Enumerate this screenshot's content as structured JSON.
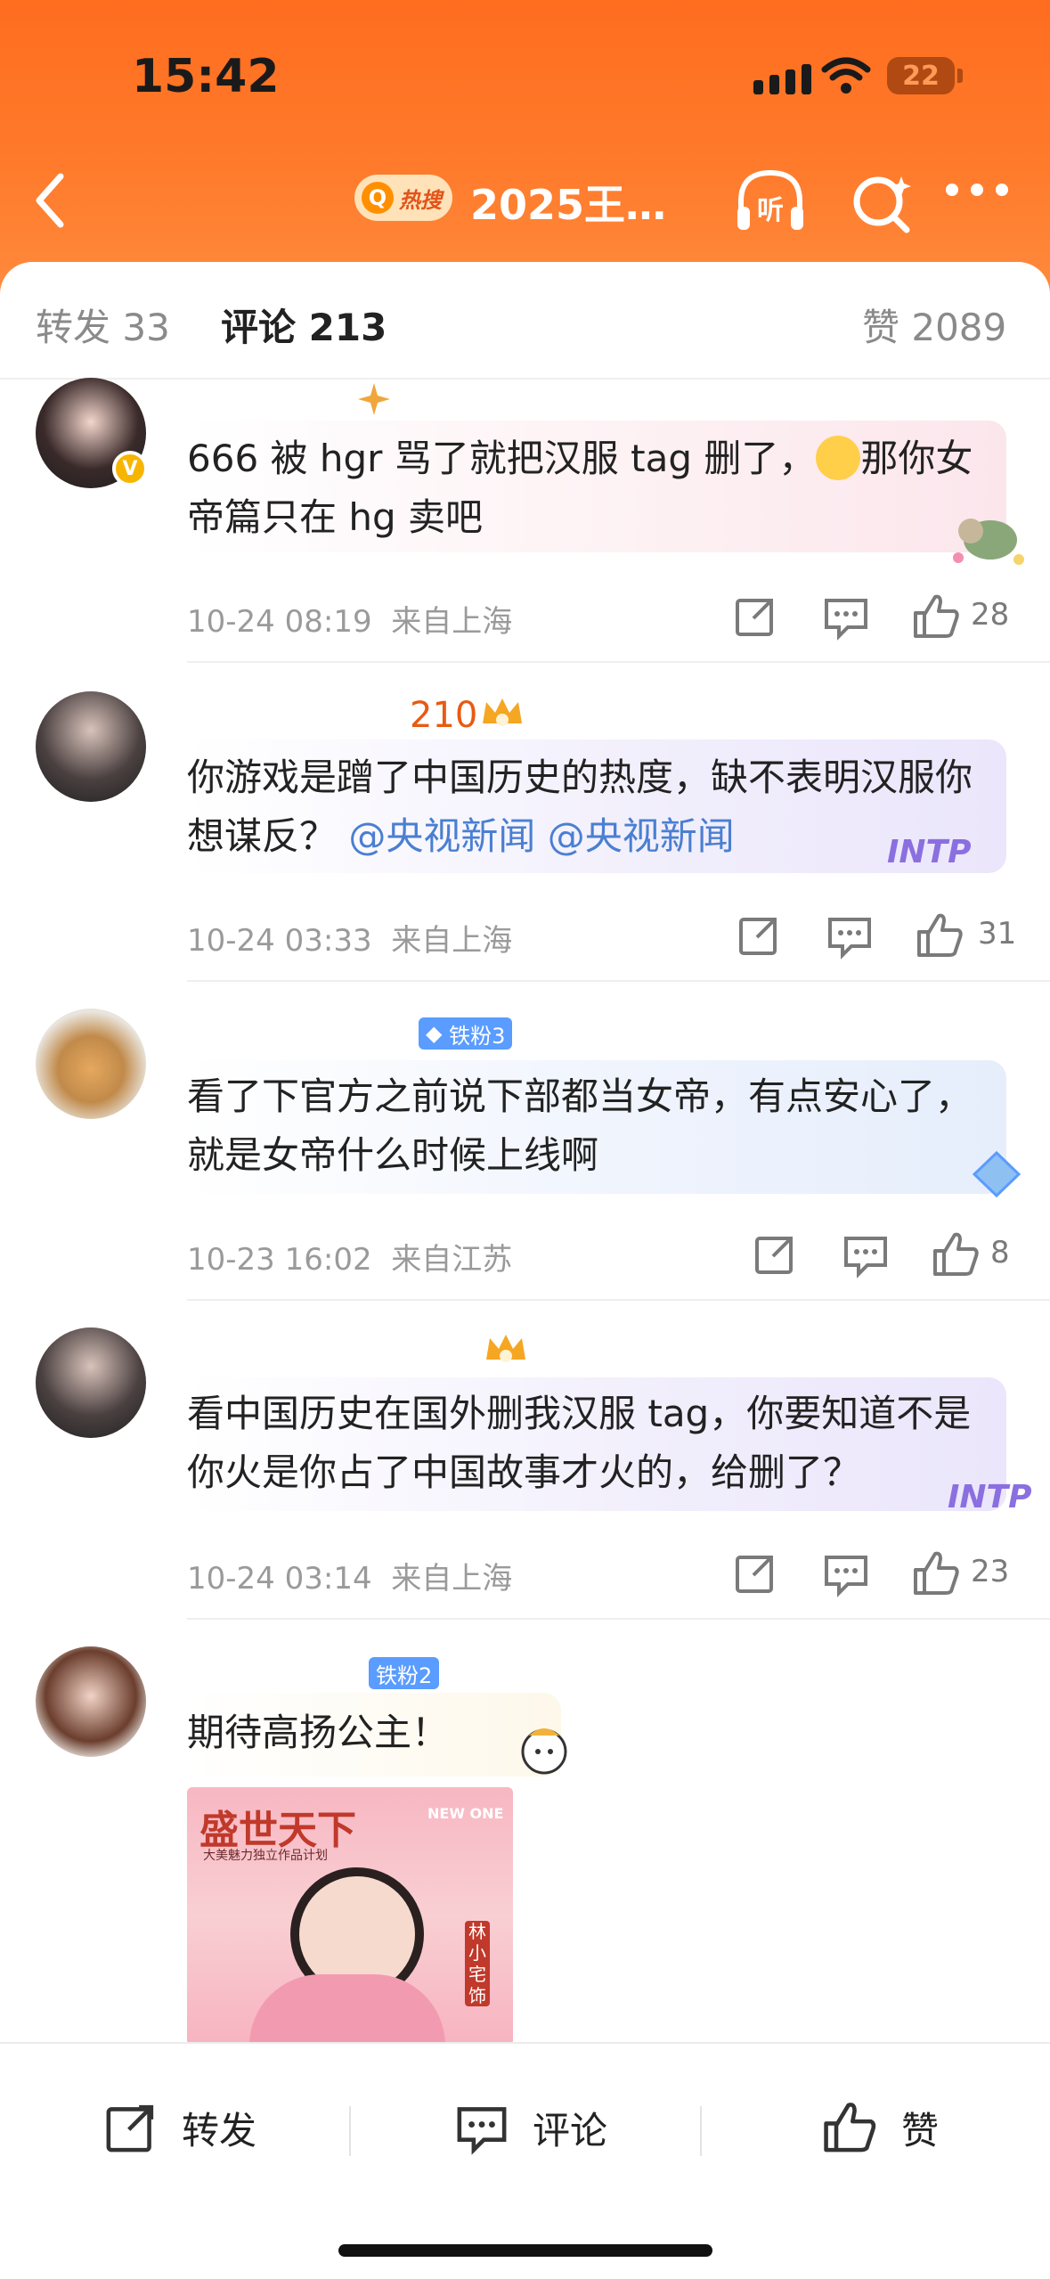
{
  "status_bar": {
    "time": "15:42",
    "battery": "22"
  },
  "nav": {
    "hot_label": "热搜",
    "title": "2025王…",
    "listen_label": "听"
  },
  "tabs": {
    "repost": "转发 33",
    "comment": "评论 213",
    "like": "赞 2089"
  },
  "comments": [
    {
      "name": "",
      "text": "666 被 hgr 骂了就把汉服 tag 删了，",
      "text_cont": "那你女帝篇只在 hg 卖吧",
      "time": "10-24 08:19",
      "location": "来自上海",
      "likes": "28"
    },
    {
      "name": "210",
      "text": "你游戏是蹭了中国历史的热度，缺不表明汉服你想谋反？",
      "mention1": "@央视新闻",
      "mention2": "@央视新闻",
      "time": "10-24 03:33",
      "location": "来自上海",
      "likes": "31",
      "decoration": "INTP"
    },
    {
      "name": "",
      "badge": "铁粉3",
      "text": "看了下官方之前说下部都当女帝，有点安心了，就是女帝什么时候上线啊",
      "time": "10-23 16:02",
      "location": "来自江苏",
      "likes": "8"
    },
    {
      "name": "",
      "text": "看中国历史在国外删我汉服 tag，你要知道不是你火是你占了中国故事才火的，给删了？",
      "time": "10-24 03:14",
      "location": "来自上海",
      "likes": "23",
      "decoration": "INTP"
    },
    {
      "name": "",
      "badge": "铁粉2",
      "text": "期待高扬公主！",
      "poster_title": "盛世天下",
      "poster_sub": "大美魅力独立作品计划",
      "poster_logo": "NEW ONE",
      "poster_tag": "林小宅饰"
    }
  ],
  "bottom_bar": {
    "repost": "转发",
    "comment": "评论",
    "like": "赞"
  },
  "colors": {
    "header_orange": "#ff6d1f",
    "accent_orange": "#e85a12",
    "mention_blue": "#4a7fd1"
  }
}
